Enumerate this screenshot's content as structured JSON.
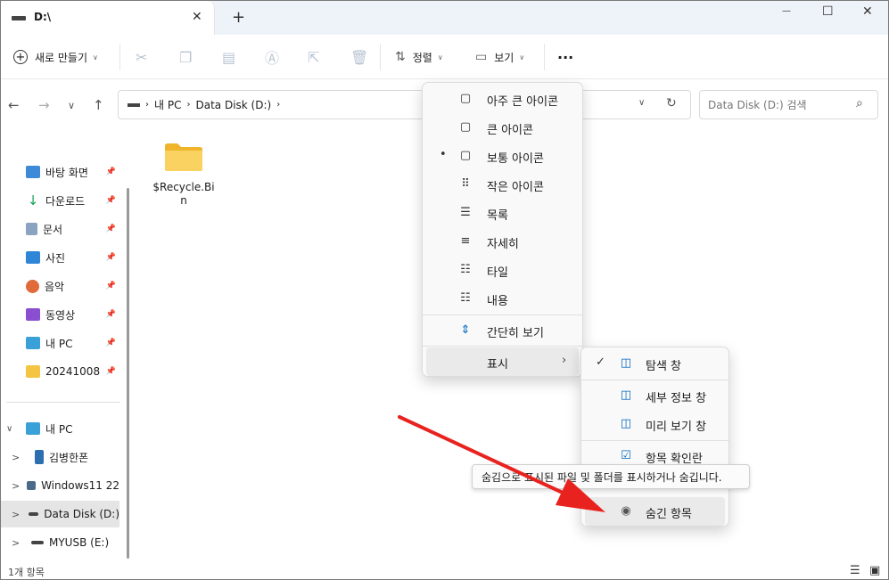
{
  "window": {
    "tab_title": "D:\\",
    "tab_close": "✕",
    "new_tab": "+",
    "controls": {
      "minimize": "—",
      "maximize": "☐",
      "close": "✕"
    }
  },
  "toolbar": {
    "new_label": "새로 만들기",
    "sort_label": "정렬",
    "view_label": "보기",
    "more_label": "···"
  },
  "address": {
    "segments": [
      "내 PC",
      "Data Disk (D:)"
    ],
    "search_placeholder": "Data Disk (D:) 검색"
  },
  "sidebar": {
    "quick": [
      {
        "label": "바탕 화면",
        "color": "#3c8ad8"
      },
      {
        "label": "다운로드",
        "color": "#19a05a"
      },
      {
        "label": "문서",
        "color": "#8aa3c0"
      },
      {
        "label": "사진",
        "color": "#2f86d6"
      },
      {
        "label": "음악",
        "color": "#e06a3a"
      },
      {
        "label": "동영상",
        "color": "#8a4fd0"
      },
      {
        "label": "내 PC",
        "color": "#3aa0d8"
      },
      {
        "label": "20241008",
        "color": "#f4c542"
      }
    ],
    "tree": [
      {
        "label": "내 PC",
        "chev": "∨"
      },
      {
        "label": "김병한폰",
        "chev": ">"
      },
      {
        "label": "Windows11 22",
        "chev": ">"
      },
      {
        "label": "Data Disk (D:)",
        "chev": ">"
      },
      {
        "label": "MYUSB (E:)",
        "chev": ">"
      }
    ]
  },
  "content": {
    "items": [
      {
        "label": "$Recycle.Bin",
        "icon": "folder-icon"
      }
    ]
  },
  "status": {
    "count": "1개 항목"
  },
  "view_menu": {
    "items": [
      {
        "label": "아주 큰 아이콘",
        "icon": "▢"
      },
      {
        "label": "큰 아이콘",
        "icon": "▢"
      },
      {
        "label": "보통 아이콘",
        "icon": "▢",
        "bullet": "•"
      },
      {
        "label": "작은 아이콘",
        "icon": "⠿"
      },
      {
        "label": "목록",
        "icon": "☰"
      },
      {
        "label": "자세히",
        "icon": "≡"
      },
      {
        "label": "타일",
        "icon": "☷"
      },
      {
        "label": "내용",
        "icon": "☷"
      }
    ],
    "compact": "간단히 보기",
    "show": "표시"
  },
  "show_menu": {
    "items": [
      {
        "label": "탐색 창",
        "check": "✓",
        "icon": "◫"
      },
      {
        "label": "세부 정보 창",
        "icon": "◫"
      },
      {
        "label": "미리 보기 창",
        "icon": "◫"
      },
      {
        "label": "항목 확인란",
        "icon": "☑"
      },
      {
        "label": "숨긴 항목",
        "icon": "◉"
      }
    ]
  },
  "tooltip": "숨김으로 표시된 파일 및 폴더를 표시하거나 숨깁니다.",
  "colors": {
    "accent": "#0067c0",
    "arrow": "#e8231f",
    "folder": "#f7c948"
  }
}
